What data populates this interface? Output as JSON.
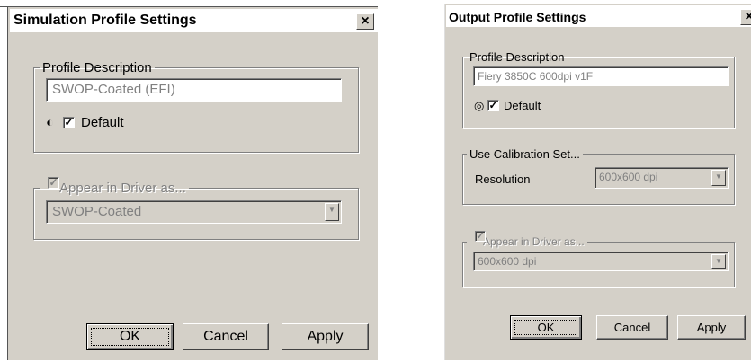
{
  "simulation": {
    "title": "Simulation Profile Settings",
    "close_label": "×",
    "profile_description": {
      "legend": "Profile Description",
      "value": "SWOP-Coated (EFI)",
      "icon": "half-circle-icon",
      "default_checked_mark": "✓",
      "default_label": "Default"
    },
    "appear_in_driver": {
      "checked_mark": "✓",
      "legend": "Appear in Driver as...",
      "value": "SWOP-Coated"
    },
    "buttons": {
      "ok": "OK",
      "cancel": "Cancel",
      "apply": "Apply"
    }
  },
  "output": {
    "title": "Output Profile Settings",
    "close_label": "×",
    "profile_description": {
      "legend": "Profile Description",
      "value": "Fiery 3850C 600dpi v1F",
      "icon": "target-circle-icon",
      "default_checked_mark": "✓",
      "default_label": "Default"
    },
    "calibration": {
      "legend": "Use Calibration Set...",
      "resolution_label": "Resolution",
      "resolution_value": "600x600 dpi"
    },
    "appear_in_driver": {
      "checked_mark": "✓",
      "legend": "Appear in Driver as...",
      "value": "600x600 dpi"
    },
    "buttons": {
      "ok": "OK",
      "cancel": "Cancel",
      "apply": "Apply"
    }
  }
}
